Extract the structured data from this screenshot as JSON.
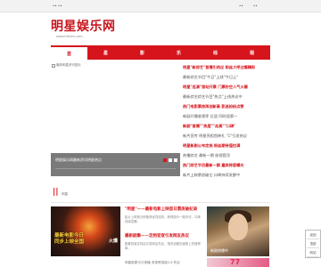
{
  "topbar": {
    "left1": "•• ••",
    "right1": "••",
    "right2": "••"
  },
  "logo": {
    "title": "明星娱乐网",
    "url": "www.tiizhen.com"
  },
  "nav": {
    "items": [
      "首",
      "星",
      "影",
      "乐",
      "综",
      "视"
    ]
  },
  "slider": {
    "broken_alt": "最新明星资讯图片",
    "caption": "明星娱乐网最新资讯明星热点"
  },
  "news": {
    "items": [
      {
        "text": "明星\"新综艺\"首播引热议 粉丝大呼过瘾精彩",
        "hl": true
      },
      {
        "text": "最新综艺节目\"今日\"上线\"今日上\"",
        "hl": false
      },
      {
        "text": "明星\"巡演\"首站开票 门票秒空人气火爆",
        "hl": true
      },
      {
        "text": "最新综艺综艺节目\"热点\"上线热议中",
        "hl": false
      },
      {
        "text": "热门电影票房再创新高 影迷纷纷点赞",
        "hl": true
      },
      {
        "text": "新剧开播收视率 位居 同时段第一",
        "hl": false
      },
      {
        "text": "新剧\"首播\"\"热度\"\"走高\"\"口碑\"",
        "hl": true
      },
      {
        "text": "新片宣传 明星亮相首映礼 \"1\"引发热议",
        "hl": false
      },
      {
        "text": "明星新剧公布定档 粉丝期待值拉满",
        "hl": true
      },
      {
        "text": "热播综艺 最新一期 收视登顶",
        "hl": false
      },
      {
        "text": "热门综艺节目最新一期 嘉宾阵容曝光",
        "hl": true
      },
      {
        "text": "新片上映票房破亿 口碑持续发酵中",
        "hl": false
      }
    ]
  },
  "section2": {
    "mark": "||",
    "subtitle": "明星"
  },
  "posters": {
    "p1_line1": "最新电影今日",
    "p1_line2": "同步上映全国",
    "p1_side": "火爆",
    "p2_caption": "新剧热播中",
    "p3_text": "77"
  },
  "midnews": [
    {
      "head": "\"明星\"——最新电影上映首日票房破纪录",
      "desc": "影片上映首日即取得优异成绩，获得观众一致好评，口碑持续发酵。"
    },
    {
      "head": "最新剧集——定档官宣引发网友热议",
      "desc": "剧集官宣定档后引发网友热议，相关话题迅速登上热搜榜单。"
    }
  ],
  "bottom": {
    "text": "明星新剧今日首播 收视率突破2.6 热议"
  },
  "sidebtn": {
    "a": "返回",
    "b": "顶部",
    "c": "网站"
  }
}
